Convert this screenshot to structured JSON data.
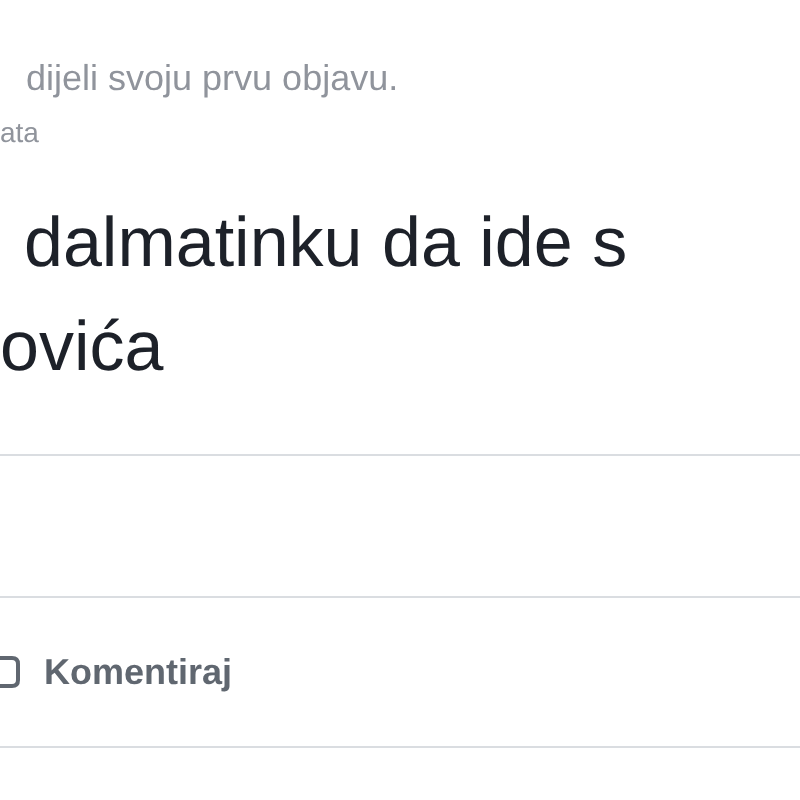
{
  "post": {
    "header_text": "dijeli svoju prvu objavu.",
    "meta": "ata",
    "title_lines": [
      "dalmatinku da ide s",
      "ovića"
    ]
  },
  "actions": [
    {
      "kind": "comment",
      "label": "Komentiraj"
    }
  ]
}
